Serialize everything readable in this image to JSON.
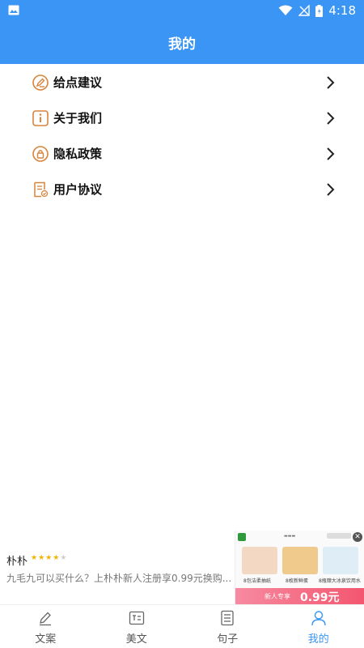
{
  "status_bar": {
    "time": "4:18"
  },
  "header": {
    "title": "我的"
  },
  "menu": {
    "items": [
      {
        "label": "给点建议",
        "icon": "edit-icon"
      },
      {
        "label": "关于我们",
        "icon": "info-icon"
      },
      {
        "label": "隐私政策",
        "icon": "privacy-icon"
      },
      {
        "label": "用户协议",
        "icon": "document-icon"
      }
    ]
  },
  "ad": {
    "app_name": "朴朴",
    "rating": 4,
    "rating_max": 5,
    "description": "九毛九可以买什么？上朴朴新人注册享0.99元换购...",
    "product_labels": [
      "8包洁柔抽纸",
      "8枚新鲜蛋",
      "8瓶肆大冰泉饮用水"
    ],
    "cta_text": "新人专享",
    "cta_price": "0.99元"
  },
  "tabs": [
    {
      "label": "文案",
      "icon": "pen-icon",
      "active": false
    },
    {
      "label": "美文",
      "icon": "article-icon",
      "active": false
    },
    {
      "label": "句子",
      "icon": "list-icon",
      "active": false
    },
    {
      "label": "我的",
      "icon": "user-icon",
      "active": true
    }
  ],
  "colors": {
    "primary": "#3a95f5",
    "icon_orange": "#d9843b",
    "star": "#f2b400"
  }
}
